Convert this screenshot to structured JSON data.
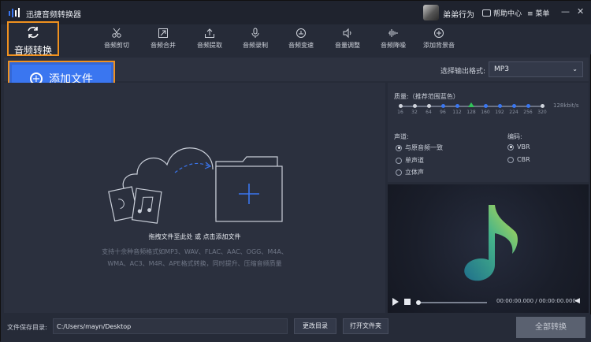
{
  "app": {
    "title": "迅捷音频转换器"
  },
  "user": {
    "name": "弟弟行为"
  },
  "titlebar": {
    "help_label": "帮助中心",
    "menu_label": "菜单",
    "minimize": "—",
    "close": "✕"
  },
  "mode": {
    "label": "音频转换"
  },
  "tools": [
    {
      "label": "音频剪切",
      "icon": "scissors-icon"
    },
    {
      "label": "音频合并",
      "icon": "merge-icon"
    },
    {
      "label": "音频提取",
      "icon": "extract-icon"
    },
    {
      "label": "音频录制",
      "icon": "microphone-icon"
    },
    {
      "label": "音频变速",
      "icon": "speed-icon"
    },
    {
      "label": "音量调整",
      "icon": "volume-icon"
    },
    {
      "label": "音频降噪",
      "icon": "denoise-icon"
    },
    {
      "label": "添加背景音",
      "icon": "background-music-icon"
    }
  ],
  "add_file": {
    "label": "添加文件"
  },
  "output_format": {
    "label": "选择输出格式:",
    "value": "MP3"
  },
  "drop_area": {
    "hint": "拖拽文件至此处 或 点击添加文件",
    "formats_line1": "支持十余种音频格式如MP3、WAV、FLAC、AAC、OGG、M4A、",
    "formats_line2": "WMA、AC3、M4R、APE格式转换，同时提升、压缩音频质量"
  },
  "settings": {
    "quality_label": "质量:（推荐范围蓝色）",
    "quality_ticks": [
      "16",
      "32",
      "64",
      "96",
      "112",
      "128",
      "160",
      "192",
      "224",
      "256",
      "320"
    ],
    "quality_selected": "128",
    "quality_unit": "128kbit/s",
    "channel_label": "声道:",
    "channel_options": [
      "与原音频一致",
      "单声道",
      "立体声"
    ],
    "channel_selected": "与原音频一致",
    "encoding_label": "编码:",
    "encoding_options": [
      "VBR",
      "CBR"
    ],
    "encoding_selected": "VBR"
  },
  "player": {
    "time": "00:00:00.000 / 00:00:00.000"
  },
  "bottom": {
    "save_dir_label": "文件保存目录:",
    "save_dir_value": "C:/Users/mayn/Desktop",
    "change_dir": "更改目录",
    "open_folder": "打开文件夹",
    "convert_all": "全部转换"
  },
  "colors": {
    "accent": "#3a76f0",
    "highlight_border": "#f0911f",
    "selected_tick": "#31c45a"
  }
}
